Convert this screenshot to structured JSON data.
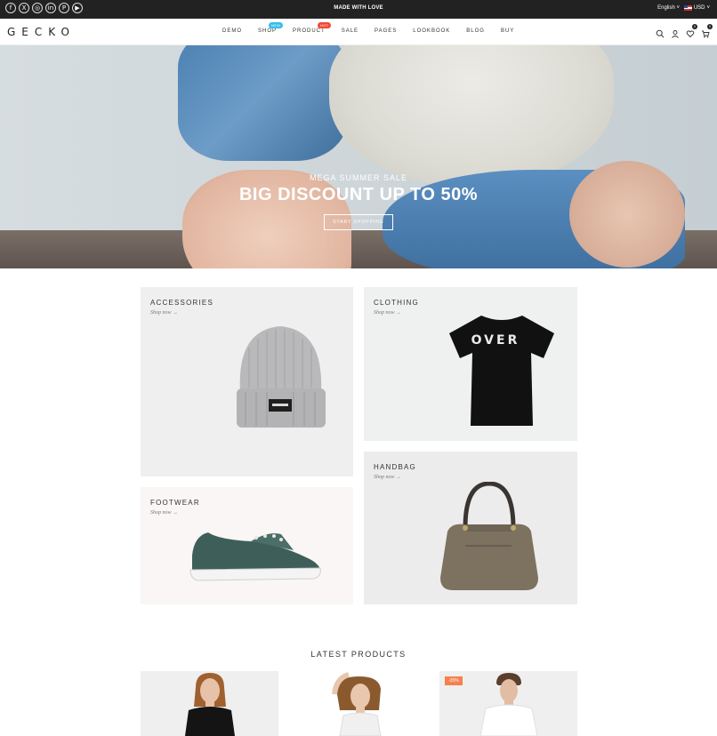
{
  "topbar": {
    "socials": [
      {
        "icon": "facebook-icon",
        "glyph": "f"
      },
      {
        "icon": "x-icon",
        "glyph": "X"
      },
      {
        "icon": "instagram-icon",
        "glyph": "◎"
      },
      {
        "icon": "linkedin-icon",
        "glyph": "in"
      },
      {
        "icon": "pinterest-icon",
        "glyph": "P"
      },
      {
        "icon": "youtube-icon",
        "glyph": "▶"
      }
    ],
    "message": "MADE WITH LOVE",
    "language": "English",
    "currency": "USD"
  },
  "header": {
    "logo": "GECKO",
    "nav": [
      {
        "label": "DEMO"
      },
      {
        "label": "SHOP",
        "badge": "NEW"
      },
      {
        "label": "PRODUCT",
        "badge": "HOT"
      },
      {
        "label": "SALE"
      },
      {
        "label": "PAGES"
      },
      {
        "label": "LOOKBOOK"
      },
      {
        "label": "BLOG"
      },
      {
        "label": "BUY"
      }
    ],
    "wishlist_count": "0",
    "cart_count": "0"
  },
  "hero": {
    "subtitle": "MEGA SUMMER SALE",
    "title": "BIG DISCOUNT UP TO 50%",
    "button": "START SHOPPING",
    "slides": 3,
    "active_slide": 1
  },
  "categories": [
    {
      "title": "ACCESSORIES",
      "link": "Shop now →"
    },
    {
      "title": "CLOTHING",
      "link": "Shop now →",
      "shirt_text": "OVER"
    },
    {
      "title": "FOOTWEAR",
      "link": "Shop now →"
    },
    {
      "title": "HANDBAG",
      "link": "Shop now →"
    }
  ],
  "latest": {
    "heading": "LATEST PRODUCTS",
    "sale_badge": "-35%"
  },
  "colors": {
    "topbar": "#222222",
    "badge_new": "#36bfe6",
    "badge_hot": "#ef4a37",
    "sale": "#f4814e"
  }
}
